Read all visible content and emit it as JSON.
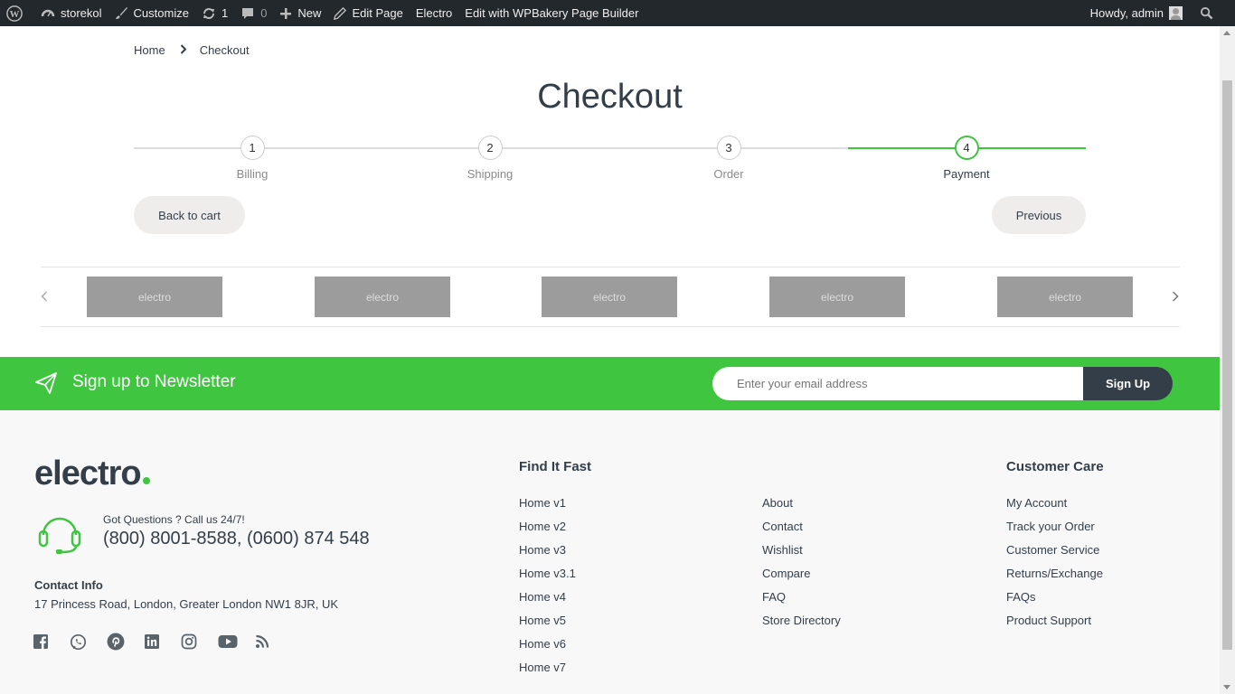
{
  "admin_bar": {
    "site_name": "storekol",
    "customize": "Customize",
    "updates_count": "1",
    "comments_count": "0",
    "new_label": "New",
    "edit_page": "Edit Page",
    "electro": "Electro",
    "wpbakery": "Edit with WPBakery Page Builder",
    "howdy": "Howdy, admin"
  },
  "breadcrumb": {
    "home": "Home",
    "current": "Checkout"
  },
  "page_title": "Checkout",
  "steps": [
    {
      "number": "1",
      "label": "Billing",
      "active": false
    },
    {
      "number": "2",
      "label": "Shipping",
      "active": false
    },
    {
      "number": "3",
      "label": "Order",
      "active": false
    },
    {
      "number": "4",
      "label": "Payment",
      "active": true
    }
  ],
  "buttons": {
    "back_to_cart": "Back to cart",
    "previous": "Previous"
  },
  "brands": [
    "electro",
    "electro",
    "electro",
    "electro",
    "electro"
  ],
  "newsletter": {
    "title": "Sign up to Newsletter",
    "placeholder": "Enter your email address",
    "button": "Sign Up"
  },
  "footer": {
    "logo_text": "electro",
    "support_small": "Got Questions ? Call us 24/7!",
    "support_phone": "(800) 8001-8588, (0600) 874 548",
    "contact_heading": "Contact Info",
    "contact_address": "17 Princess Road, London, Greater London NW1 8JR, UK",
    "socials": [
      "facebook-icon",
      "whatsapp-icon",
      "pinterest-icon",
      "linkedin-icon",
      "instagram-icon",
      "youtube-icon",
      "rss-icon"
    ],
    "find_it_fast": {
      "heading": "Find It Fast",
      "col1": [
        "Home v1",
        "Home v2",
        "Home v3",
        "Home v3.1",
        "Home v4",
        "Home v5",
        "Home v6",
        "Home v7"
      ],
      "col2": [
        "About",
        "Contact",
        "Wishlist",
        "Compare",
        "FAQ",
        "Store Directory"
      ]
    },
    "customer_care": {
      "heading": "Customer Care",
      "links": [
        "My Account",
        "Track your Order",
        "Customer Service",
        "Returns/Exchange",
        "FAQs",
        "Product Support"
      ]
    }
  },
  "colors": {
    "accent": "#3fc53f",
    "dark": "#333e48",
    "adminbar": "#23282d"
  }
}
